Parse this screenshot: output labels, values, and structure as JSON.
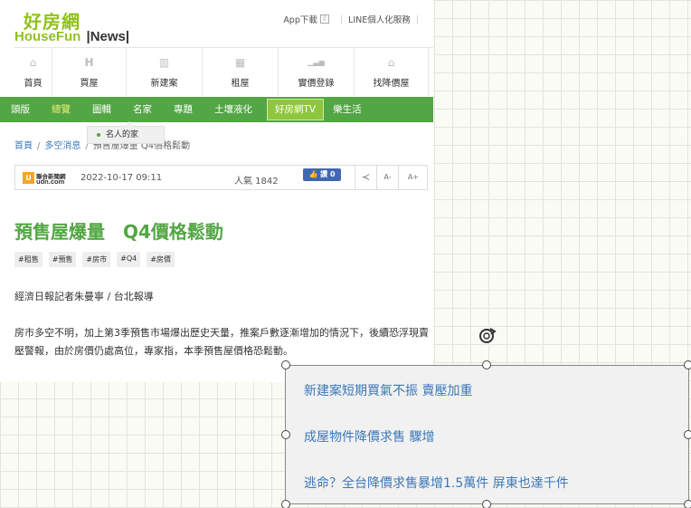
{
  "header": {
    "logo_zh": "好房網",
    "logo_en": "HouseFun",
    "logo_news": "News",
    "app_download": "App下載",
    "qr_glyph": "⠿",
    "line_service": "LINE個人化服務"
  },
  "icon_nav": [
    {
      "label": "首頁",
      "icon": "home-icon",
      "glyph": "⌂"
    },
    {
      "label": "買屋",
      "icon": "house-icon",
      "glyph": "H"
    },
    {
      "label": "新建案",
      "icon": "building-icon",
      "glyph": "▥"
    },
    {
      "label": "租屋",
      "icon": "rent-icon",
      "glyph": "▦"
    },
    {
      "label": "實價登錄",
      "icon": "chart-icon",
      "glyph": "▁▃▅"
    },
    {
      "label": "找降價屋",
      "icon": "price-drop-house-icon",
      "glyph": "⌂"
    }
  ],
  "green_nav": [
    "頭版",
    "總覽",
    "圖輯",
    "名家",
    "專題",
    "土壤液化",
    "好房網TV",
    "樂生活"
  ],
  "dropdown": {
    "item": "名人的家"
  },
  "breadcrumb": {
    "home": "首頁",
    "section": "多空消息",
    "current": "預售屋爆量 Q4價格鬆動"
  },
  "meta": {
    "source_line1": "聯合新聞網",
    "source_line2": "udn.com",
    "date": "2022-10-17 09:11",
    "views": "人氣 1842",
    "like": "👍 讚 0",
    "share_glyph": "≺",
    "font_smaller": "A-",
    "font_larger": "A+"
  },
  "article": {
    "title": "預售屋爆量　Q4價格鬆動",
    "tags": [
      "#租售",
      "#預售",
      "#房市",
      "#Q4",
      "#房價"
    ],
    "byline": "經濟日報記者朱曼寧 / 台北報導",
    "body": "房市多空不明，加上第3季預售市場爆出歷史天量，推案戶數逐漸增加的情況下，後續恐浮現賣壓警報，由於房價仍處高位，專家指，本季預售屋價格恐鬆動。"
  },
  "related_links": [
    "新建案短期買氣不振 賣壓加重",
    "成屋物件降價求售 驟增",
    "逃命？全台降價求售暴增1.5萬件 屏東也達千件"
  ],
  "colors": {
    "green": "#52a644",
    "link": "#3b78b9",
    "logo": "#8fc21c"
  }
}
